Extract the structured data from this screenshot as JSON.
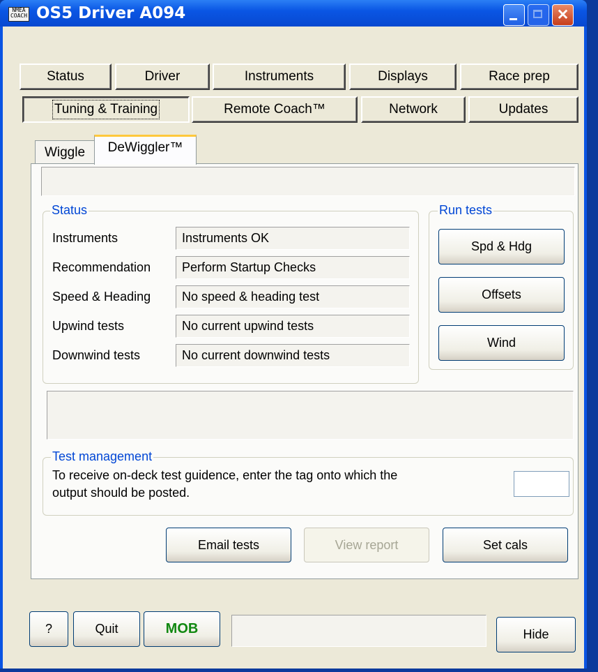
{
  "window": {
    "title": "OS5 Driver A094",
    "icon_text": "NMEA COACH"
  },
  "caption_buttons": {
    "minimize_icon": "minimize-icon",
    "maximize_icon": "maximize-icon",
    "close_icon": "close-icon"
  },
  "top_tabs_row1": [
    "Status",
    "Driver",
    "Instruments",
    "Displays",
    "Race prep"
  ],
  "top_tabs_row2": [
    "Tuning & Training",
    "Remote Coach™",
    "Network",
    "Updates"
  ],
  "sub_tabs": [
    "Wiggle",
    "DeWiggler™"
  ],
  "status": {
    "label": "Status",
    "rows": [
      {
        "label": "Instruments",
        "value": "Instruments OK"
      },
      {
        "label": "Recommendation",
        "value": "Perform Startup Checks"
      },
      {
        "label": "Speed & Heading",
        "value": "No speed & heading test"
      },
      {
        "label": "Upwind tests",
        "value": "No current upwind tests"
      },
      {
        "label": "Downwind tests",
        "value": "No current downwind tests"
      }
    ]
  },
  "run_tests": {
    "label": "Run tests",
    "buttons": [
      "Spd & Hdg",
      "Offsets",
      "Wind"
    ]
  },
  "test_management": {
    "label": "Test management",
    "text_line1": "To receive on-deck test guidence, enter the tag onto which the",
    "text_line2": "output should be posted.",
    "tag_value": ""
  },
  "actions": {
    "email": "Email tests",
    "report": "View report",
    "setcals": "Set cals"
  },
  "bottom": {
    "help": "?",
    "quit": "Quit",
    "mob": "MOB",
    "status_text": "",
    "hide": "Hide"
  }
}
